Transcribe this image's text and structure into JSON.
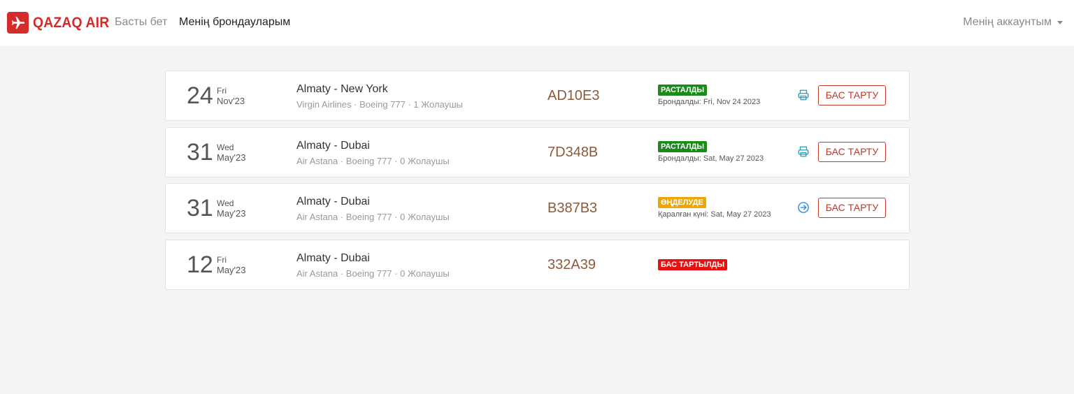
{
  "brand": {
    "name": "QAZAQ AIR",
    "color": "#d62b2b",
    "logo_icon": "airplane-icon"
  },
  "nav": {
    "home": "Басты бет",
    "bookings": "Менің брондауларым"
  },
  "account": {
    "label": "Менің аккаунтым"
  },
  "bookings": [
    {
      "day": "24",
      "dow": "Fri",
      "month": "Nov'23",
      "route": "Almaty - New York",
      "meta": "Virgin Airlines · Boeing 777 · 1 Жолаушы",
      "pnr": "AD10E3",
      "status": "РАСТАЛДЫ",
      "status_color": "#1a8a1a",
      "subdate": "Брондалды: Fri, Nov 24 2023",
      "action_icon": "printer-icon",
      "cancel_label": "БАС ТАРТУ"
    },
    {
      "day": "31",
      "dow": "Wed",
      "month": "May'23",
      "route": "Almaty - Dubai",
      "meta": "Air Astana · Boeing 777 · 0 Жолаушы",
      "pnr": "7D348B",
      "status": "РАСТАЛДЫ",
      "status_color": "#1a8a1a",
      "subdate": "Брондалды: Sat, May 27 2023",
      "action_icon": "printer-icon",
      "cancel_label": "БАС ТАРТУ"
    },
    {
      "day": "31",
      "dow": "Wed",
      "month": "May'23",
      "route": "Almaty - Dubai",
      "meta": "Air Astana · Boeing 777 · 0 Жолаушы",
      "pnr": "B387B3",
      "status": "ӨҢДЕЛУДЕ",
      "status_color": "#f0a500",
      "subdate": "Қаралған күні: Sat, May 27 2023",
      "action_icon": "arrow-right-circle-icon",
      "cancel_label": "БАС ТАРТУ"
    },
    {
      "day": "12",
      "dow": "Fri",
      "month": "May'23",
      "route": "Almaty - Dubai",
      "meta": "Air Astana · Boeing 777 · 0 Жолаушы",
      "pnr": "332A39",
      "status": "БАС ТАРТЫЛДЫ",
      "status_color": "#e81010"
    }
  ]
}
